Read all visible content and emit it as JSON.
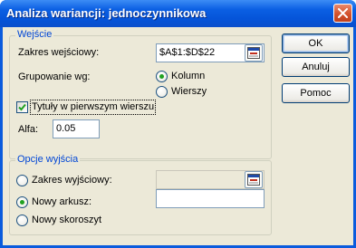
{
  "window": {
    "title": "Analiza wariancji: jednoczynnikowa"
  },
  "input_group": {
    "title": "Wejście",
    "range_label": "Zakres wejściowy:",
    "range_value": "$A$1:$D$22",
    "grouping_label": "Grupowanie wg:",
    "grouping_options": [
      "Kolumn",
      "Wierszy"
    ],
    "grouping_selected": "Kolumn",
    "labels_checkbox": "Tytuły w pierwszym wierszu",
    "labels_checked": true,
    "alpha_label": "Alfa:",
    "alpha_value": "0.05"
  },
  "output_group": {
    "title": "Opcje wyjścia",
    "options": [
      "Zakres wyjściowy:",
      "Nowy arkusz:",
      "Nowy skoroszyt"
    ],
    "selected": "Nowy arkusz:",
    "output_range_value": "",
    "new_sheet_value": ""
  },
  "buttons": {
    "ok": "OK",
    "cancel": "Anuluj",
    "help": "Pomoc"
  },
  "colors": {
    "title_bar": "#0554d9",
    "group_title": "#0046d5",
    "dialog_bg": "#ece9d8"
  }
}
